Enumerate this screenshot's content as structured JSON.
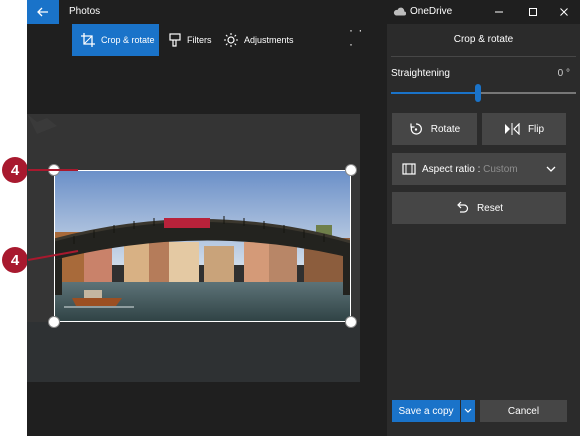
{
  "window": {
    "app_title": "Photos",
    "onedrive_label": "OneDrive"
  },
  "toolbar": {
    "crop_rotate_label": "Crop & rotate",
    "filters_label": "Filters",
    "adjustments_label": "Adjustments",
    "more_label": "· · ·"
  },
  "panel": {
    "title": "Crop & rotate",
    "straightening_label": "Straightening",
    "straightening_value": "0 °",
    "straightening_level_percent": 47,
    "rotate_label": "Rotate",
    "flip_label": "Flip",
    "aspect_label": "Aspect ratio : ",
    "aspect_value": "Custom",
    "reset_label": "Reset",
    "save_copy_label": "Save a copy",
    "cancel_label": "Cancel"
  },
  "callouts": {
    "first": "4",
    "second": "4"
  },
  "colors": {
    "accent": "#1a73c9",
    "callout": "#a8192e"
  }
}
